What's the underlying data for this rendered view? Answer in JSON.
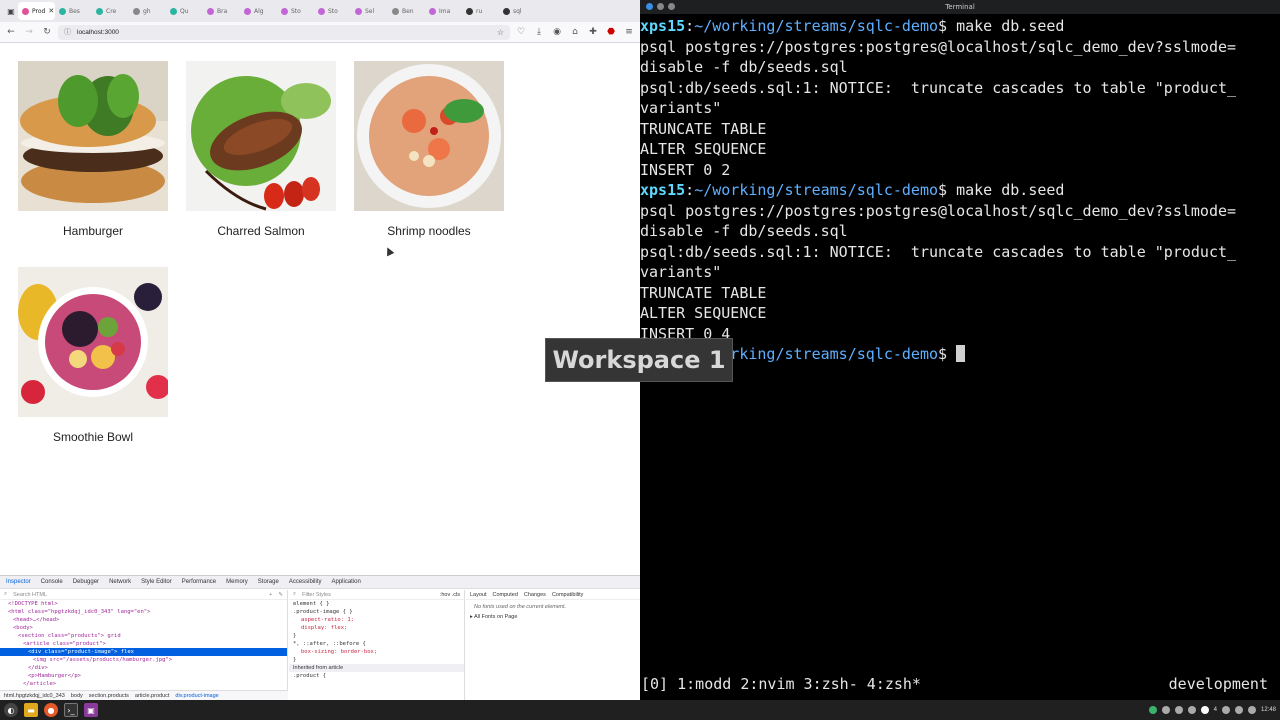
{
  "browser": {
    "tabs": [
      {
        "label": "Prod",
        "color": "#e05297",
        "active": true
      },
      {
        "label": "Bes",
        "color": "#2bb5a0"
      },
      {
        "label": "Cre",
        "color": "#2bb5a0"
      },
      {
        "label": "gh",
        "color": "#888888"
      },
      {
        "label": "Qu",
        "color": "#2bb5a0"
      },
      {
        "label": "Bra",
        "color": "#c266d6"
      },
      {
        "label": "Alg",
        "color": "#c266d6"
      },
      {
        "label": "Sto",
        "color": "#c266d6"
      },
      {
        "label": "Sto",
        "color": "#c266d6"
      },
      {
        "label": "Sel",
        "color": "#c266d6"
      },
      {
        "label": "Ben",
        "color": "#888888"
      },
      {
        "label": "Ima",
        "color": "#c266d6"
      },
      {
        "label": "ru",
        "color": "#333333"
      },
      {
        "label": "sql",
        "color": "#333333"
      }
    ],
    "url": "localhost:3000",
    "products": [
      {
        "name": "Hamburger"
      },
      {
        "name": "Charred Salmon"
      },
      {
        "name": "Shrimp noodles"
      },
      {
        "name": "Smoothie Bowl"
      }
    ]
  },
  "devtools": {
    "tabs": [
      "Inspector",
      "Console",
      "Debugger",
      "Network",
      "Style Editor",
      "Performance",
      "Memory",
      "Storage",
      "Accessibility",
      "Application"
    ],
    "search_placeholder": "Search HTML",
    "filter_placeholder": "Filter Styles",
    "html_lines": [
      "<!DOCTYPE html>",
      "<html class=\"hpgtzkdqj_idc0_343\" lang=\"en\">",
      "<head>…</head>",
      "<body>",
      "<section class=\"products\"> grid",
      "<article class=\"product\">",
      "<div class=\"product-image\"> flex",
      "<img src=\"/assets/products/hamburger.jpg\">",
      "</div>",
      "<p>Hamburger</p>",
      "</article>"
    ],
    "rules_lines": [
      "element { }",
      ".product-image { }",
      "aspect-ratio: 1;",
      "display: flex;",
      "}",
      "*, ::after, ::before {",
      "box-sizing: border-box;",
      "}",
      "Inherited from article",
      ".product {"
    ],
    "rule_sources": [
      "inline",
      "inline:35",
      "inline:1",
      "inline:24"
    ],
    "layout_tabs": [
      "Layout",
      "Computed",
      "Changes",
      "Compatibility"
    ],
    "fonts_note": "No fonts used on the current element.",
    "fonts_section": "All Fonts on Page",
    "breadcrumbs": [
      "html.hpgtzkdqj_idc0_343",
      "body",
      "section.products",
      "article.product",
      "div.product-image"
    ],
    "rules_toolbar": ":hov .cls"
  },
  "terminal": {
    "title": "Terminal",
    "lines": [
      {
        "type": "prompt",
        "host": "xps15",
        "path": "~/working/streams/sqlc-demo",
        "cmd": "make db.seed"
      },
      {
        "type": "out",
        "text": "psql postgres://postgres:postgres@localhost/sqlc_demo_dev?sslmode="
      },
      {
        "type": "out",
        "text": "disable -f db/seeds.sql"
      },
      {
        "type": "out",
        "text": "psql:db/seeds.sql:1: NOTICE:  truncate cascades to table \"product_"
      },
      {
        "type": "out",
        "text": "variants\""
      },
      {
        "type": "out",
        "text": "TRUNCATE TABLE"
      },
      {
        "type": "out",
        "text": "ALTER SEQUENCE"
      },
      {
        "type": "out",
        "text": "INSERT 0 2"
      },
      {
        "type": "prompt",
        "host": "xps15",
        "path": "~/working/streams/sqlc-demo",
        "cmd": "make db.seed"
      },
      {
        "type": "out",
        "text": "psql postgres://postgres:postgres@localhost/sqlc_demo_dev?sslmode="
      },
      {
        "type": "out",
        "text": "disable -f db/seeds.sql"
      },
      {
        "type": "out",
        "text": "psql:db/seeds.sql:1: NOTICE:  truncate cascades to table \"product_"
      },
      {
        "type": "out",
        "text": "variants\""
      },
      {
        "type": "out",
        "text": "TRUNCATE TABLE"
      },
      {
        "type": "out",
        "text": "ALTER SEQUENCE"
      },
      {
        "type": "out",
        "text": "INSERT 0 4"
      },
      {
        "type": "prompt",
        "host": "xps15",
        "path": "~/working/streams/sqlc-demo",
        "cmd": ""
      }
    ],
    "tmux_left": "[0] 1:modd  2:nvim  3:zsh- 4:zsh*",
    "tmux_right": "development"
  },
  "overlay": {
    "text": "Workspace 1"
  },
  "taskbar": {
    "clock": "12:48",
    "tray_number": "4"
  },
  "colors": {
    "host": "#5fd7ff",
    "path": "#5fafff",
    "accent": "#0060df"
  }
}
